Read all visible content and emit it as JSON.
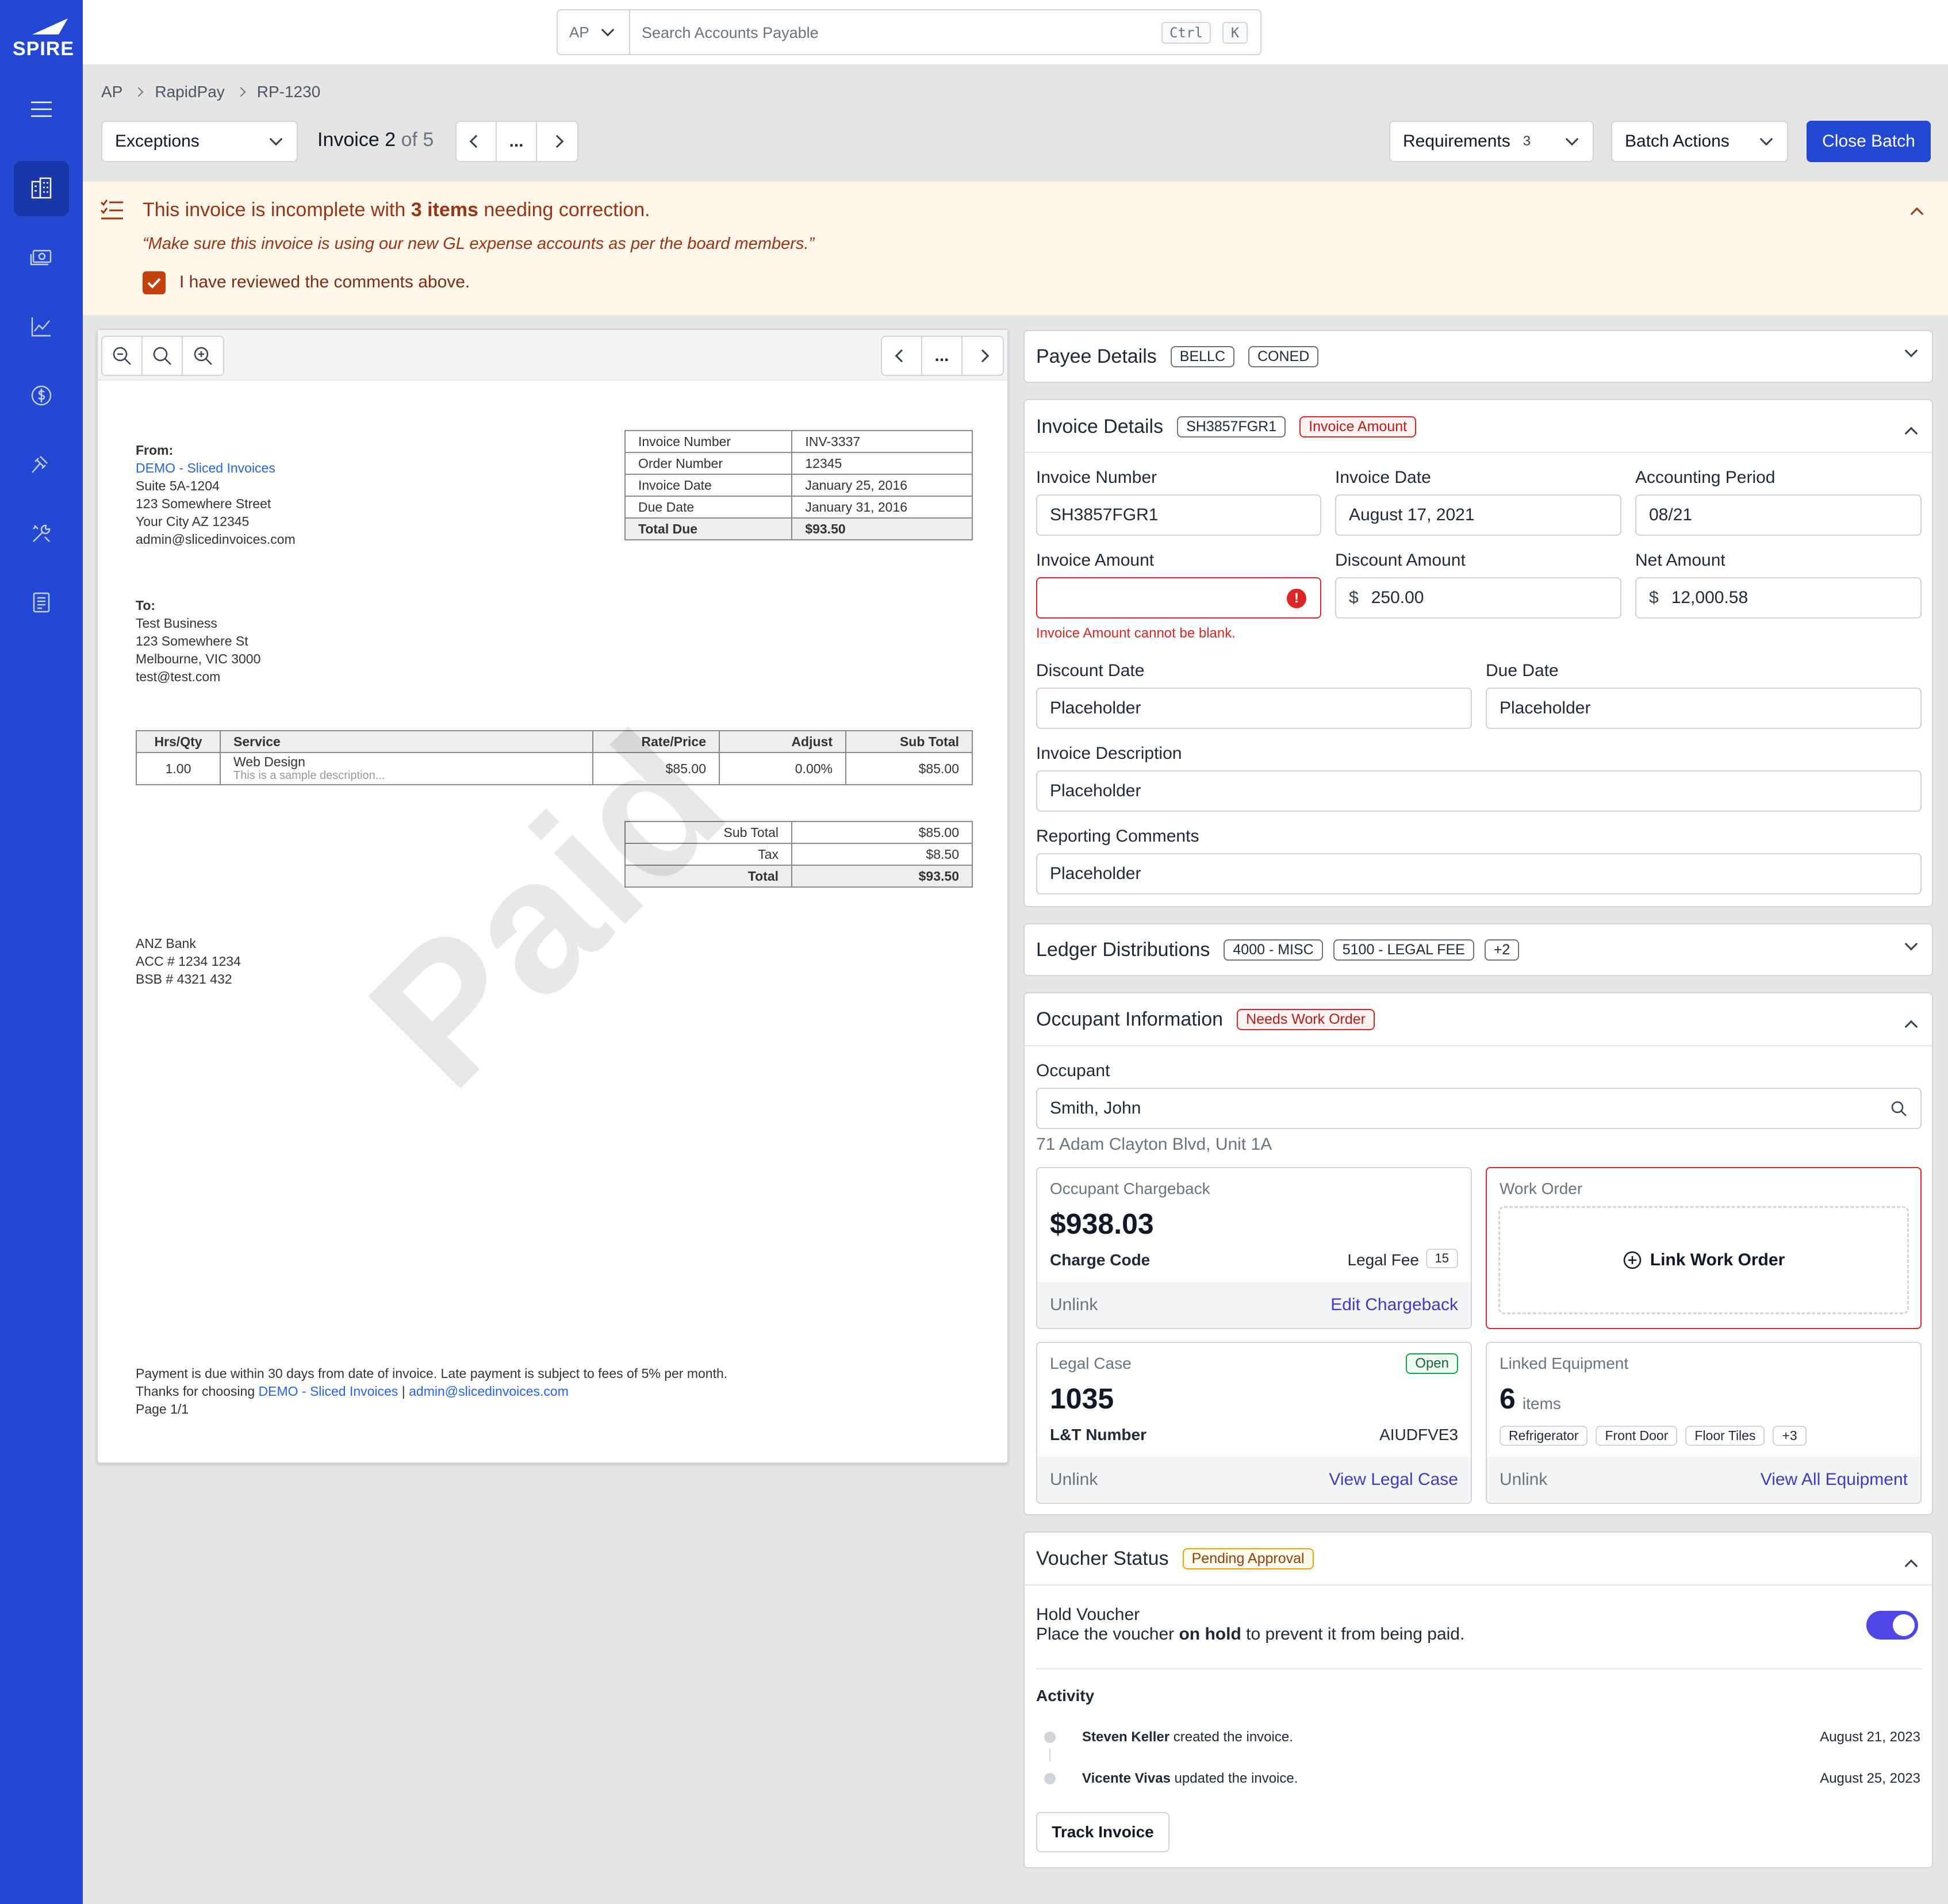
{
  "app": {
    "logo": "SPIRE"
  },
  "search": {
    "scope": "AP",
    "placeholder": "Search Accounts Payable",
    "kbd1": "Ctrl",
    "kbd2": "K"
  },
  "breadcrumb": [
    "AP",
    "RapidPay",
    "RP-1230"
  ],
  "toolbar": {
    "filter": "Exceptions",
    "invoice_prefix": "Invoice",
    "invoice_index": "2",
    "invoice_of": "of 5",
    "more": "...",
    "requirements_label": "Requirements",
    "requirements_count": "3",
    "batch_actions": "Batch Actions",
    "close_batch": "Close Batch"
  },
  "banner": {
    "title_pre": "This invoice is incomplete with ",
    "title_bold": "3 items",
    "title_post": " needing correction.",
    "quote": "“Make sure this invoice is using our new GL expense accounts as per the board members.”",
    "check_label": "I have reviewed the comments above.",
    "checked": true
  },
  "viewer": {
    "more": "..."
  },
  "document": {
    "from_label": "From:",
    "from_name": "DEMO - Sliced Invoices",
    "from_lines": [
      "Suite 5A-1204",
      "123 Somewhere Street",
      "Your City AZ 12345",
      "admin@slicedinvoices.com"
    ],
    "to_label": "To:",
    "to_lines": [
      "Test Business",
      "123 Somewhere St",
      "Melbourne, VIC 3000",
      "test@test.com"
    ],
    "meta": [
      [
        "Invoice Number",
        "INV-3337"
      ],
      [
        "Order Number",
        "12345"
      ],
      [
        "Invoice Date",
        "January 25, 2016"
      ],
      [
        "Due Date",
        "January 31, 2016"
      ],
      [
        "Total Due",
        "$93.50"
      ]
    ],
    "items_header": [
      "Hrs/Qty",
      "Service",
      "Rate/Price",
      "Adjust",
      "Sub Total"
    ],
    "item": {
      "qty": "1.00",
      "service": "Web Design",
      "desc": "This is a sample description...",
      "rate": "$85.00",
      "adjust": "0.00%",
      "subtotal": "$85.00"
    },
    "totals": [
      [
        "Sub Total",
        "$85.00"
      ],
      [
        "Tax",
        "$8.50"
      ],
      [
        "Total",
        "$93.50"
      ]
    ],
    "bank": [
      "ANZ Bank",
      "ACC # 1234 1234",
      "BSB # 4321 432"
    ],
    "watermark": "Paid",
    "footer1": "Payment is due within 30 days from date of invoice. Late payment is subject to fees of 5% per month.",
    "footer2_pre": "Thanks for choosing ",
    "footer2_link1": "DEMO - Sliced Invoices",
    "footer2_sep": " | ",
    "footer2_link2": "admin@slicedinvoices.com",
    "footer3": "Page 1/1"
  },
  "payee": {
    "title": "Payee Details",
    "tags": [
      "BELLC",
      "CONED"
    ]
  },
  "invoice_details": {
    "title": "Invoice Details",
    "tag1": "SH3857FGR1",
    "tag2": "Invoice Amount",
    "invoice_number_label": "Invoice Number",
    "invoice_number": "SH3857FGR1",
    "invoice_date_label": "Invoice Date",
    "invoice_date": "August 17, 2021",
    "period_label": "Accounting Period",
    "period": "08/21",
    "amount_label": "Invoice Amount",
    "amount_error": "Invoice Amount cannot be blank.",
    "error_icon": "!",
    "discount_label": "Discount Amount",
    "discount": "250.00",
    "net_label": "Net Amount",
    "net": "12,000.58",
    "currency": "$",
    "discount_date_label": "Discount Date",
    "discount_date": "Placeholder",
    "due_date_label": "Due Date",
    "due_date": "Placeholder",
    "desc_label": "Invoice Description",
    "desc": "Placeholder",
    "comments_label": "Reporting Comments",
    "comments": "Placeholder"
  },
  "ledger": {
    "title": "Ledger Distributions",
    "tags": [
      "4000 - MISC",
      "5100 - LEGAL FEE",
      "+2"
    ]
  },
  "occupant": {
    "title": "Occupant Information",
    "tag": "Needs Work Order",
    "occupant_label": "Occupant",
    "occupant": "Smith, John",
    "address": "71 Adam Clayton Blvd, Unit 1A",
    "chargeback": {
      "label": "Occupant Chargeback",
      "amount": "$938.03",
      "code_label": "Charge Code",
      "code_value": "Legal Fee",
      "code_num": "15",
      "unlink": "Unlink",
      "action": "Edit Chargeback"
    },
    "work_order": {
      "label": "Work Order",
      "action": "Link Work Order"
    },
    "legal": {
      "label": "Legal Case",
      "status": "Open",
      "number": "1035",
      "lt_label": "L&T Number",
      "lt_value": "AIUDFVE3",
      "unlink": "Unlink",
      "action": "View Legal Case"
    },
    "equipment": {
      "label": "Linked Equipment",
      "count": "6",
      "unit": "items",
      "tags": [
        "Refrigerator",
        "Front Door",
        "Floor Tiles",
        "+3"
      ],
      "unlink": "Unlink",
      "action": "View All Equipment"
    }
  },
  "voucher": {
    "title": "Voucher Status",
    "tag": "Pending Approval",
    "hold_title": "Hold Voucher",
    "hold_pre": "Place the voucher ",
    "hold_bold": "on hold",
    "hold_post": " to prevent it from being paid.",
    "hold_on": true,
    "activity_label": "Activity",
    "activity": [
      {
        "who": "Steven Keller",
        "what": " created the invoice.",
        "date": "August 21, 2023"
      },
      {
        "who": "Vicente Vivas",
        "what": " updated the invoice.",
        "date": "August 25, 2023"
      }
    ],
    "track": "Track Invoice"
  },
  "colors": {
    "brand": "#2348d4",
    "error": "#dc2626",
    "banner_bg": "#fef7e9",
    "banner_text": "#9a3412",
    "link": "#4338ca"
  }
}
